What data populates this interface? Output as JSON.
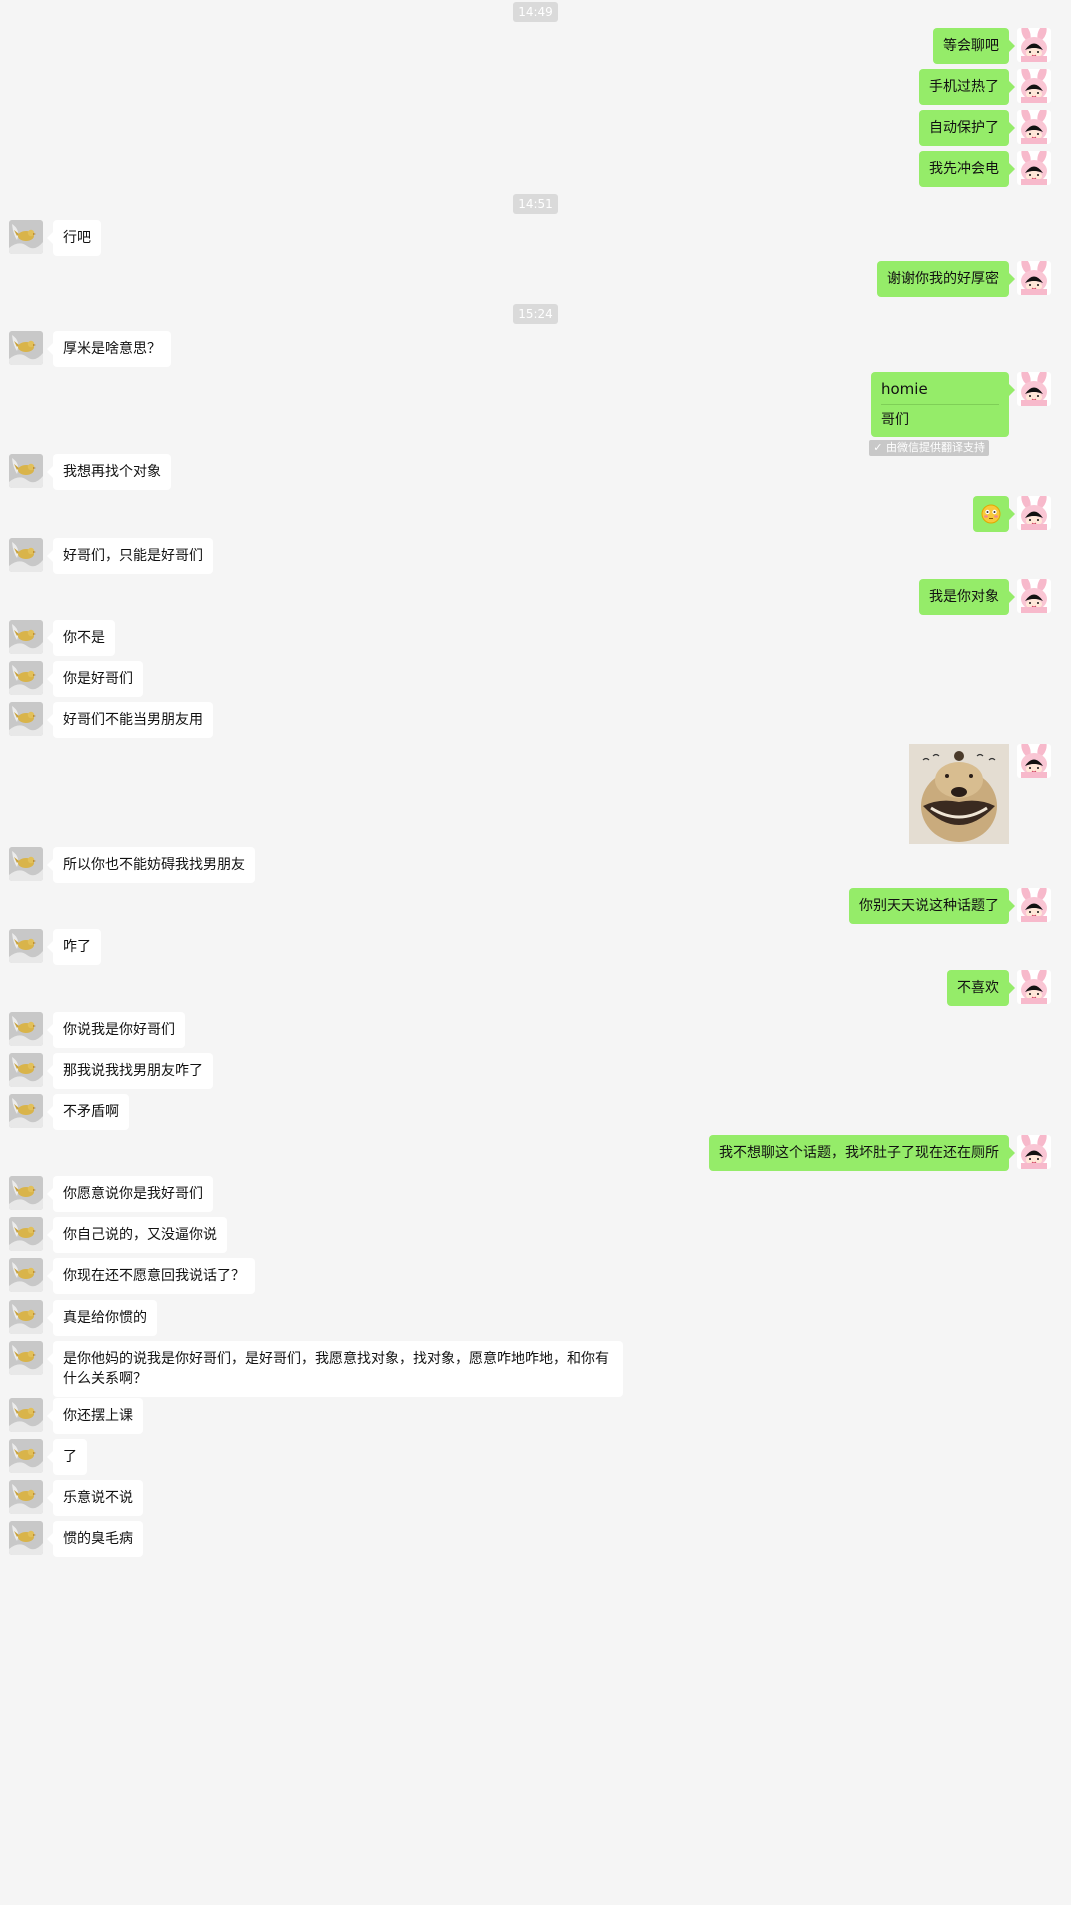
{
  "timestamps": [
    "14:49",
    "14:51",
    "15:24"
  ],
  "messages": {
    "m1": "等会聊吧",
    "m2": "手机过热了",
    "m3": "自动保护了",
    "m4": "我先冲会电",
    "m5": "行吧",
    "m6": "谢谢你我的好厚密",
    "m7": "厚米是啥意思？",
    "m8_original": "homie",
    "m8_translation": "哥们",
    "m8_note": "由微信提供翻译支持",
    "m9": "我想再找个对象",
    "m11": "好哥们，只能是好哥们",
    "m12": "我是你对象",
    "m13": "你不是",
    "m14": "你是好哥们",
    "m15": "好哥们不能当男朋友用",
    "m17": "所以你也不能妨碍我找男朋友",
    "m18": "你别天天说这种话题了",
    "m19": "咋了",
    "m20": "不喜欢",
    "m21": "你说我是你好哥们",
    "m22": "那我说我找男朋友咋了",
    "m23": "不矛盾啊",
    "m24": "我不想聊这个话题，我坏肚子了现在还在厕所",
    "m25": "你愿意说你是我好哥们",
    "m26": "你自己说的，又没逼你说",
    "m27": "你现在还不愿意回我说话了？",
    "m28": "真是给你惯的",
    "m29": "是你他妈的说我是你好哥们，是好哥们，我愿意找对象，找对象，愿意咋地咋地，和你有什么关系啊？",
    "m30": "你还摆上课",
    "m31": "了",
    "m32": "乐意说不说",
    "m33": "惯的臭毛病"
  },
  "icons": {
    "friend_avatar": "golden-bird-avatar",
    "self_avatar": "pink-bunny-avatar",
    "emoji": "flushed-face-emoji",
    "photo": "smiling-dog-photo"
  },
  "colors": {
    "background": "#f5f5f5",
    "self_bubble": "#95ec69",
    "friend_bubble": "#ffffff",
    "timestamp_bg": "#dadada"
  }
}
